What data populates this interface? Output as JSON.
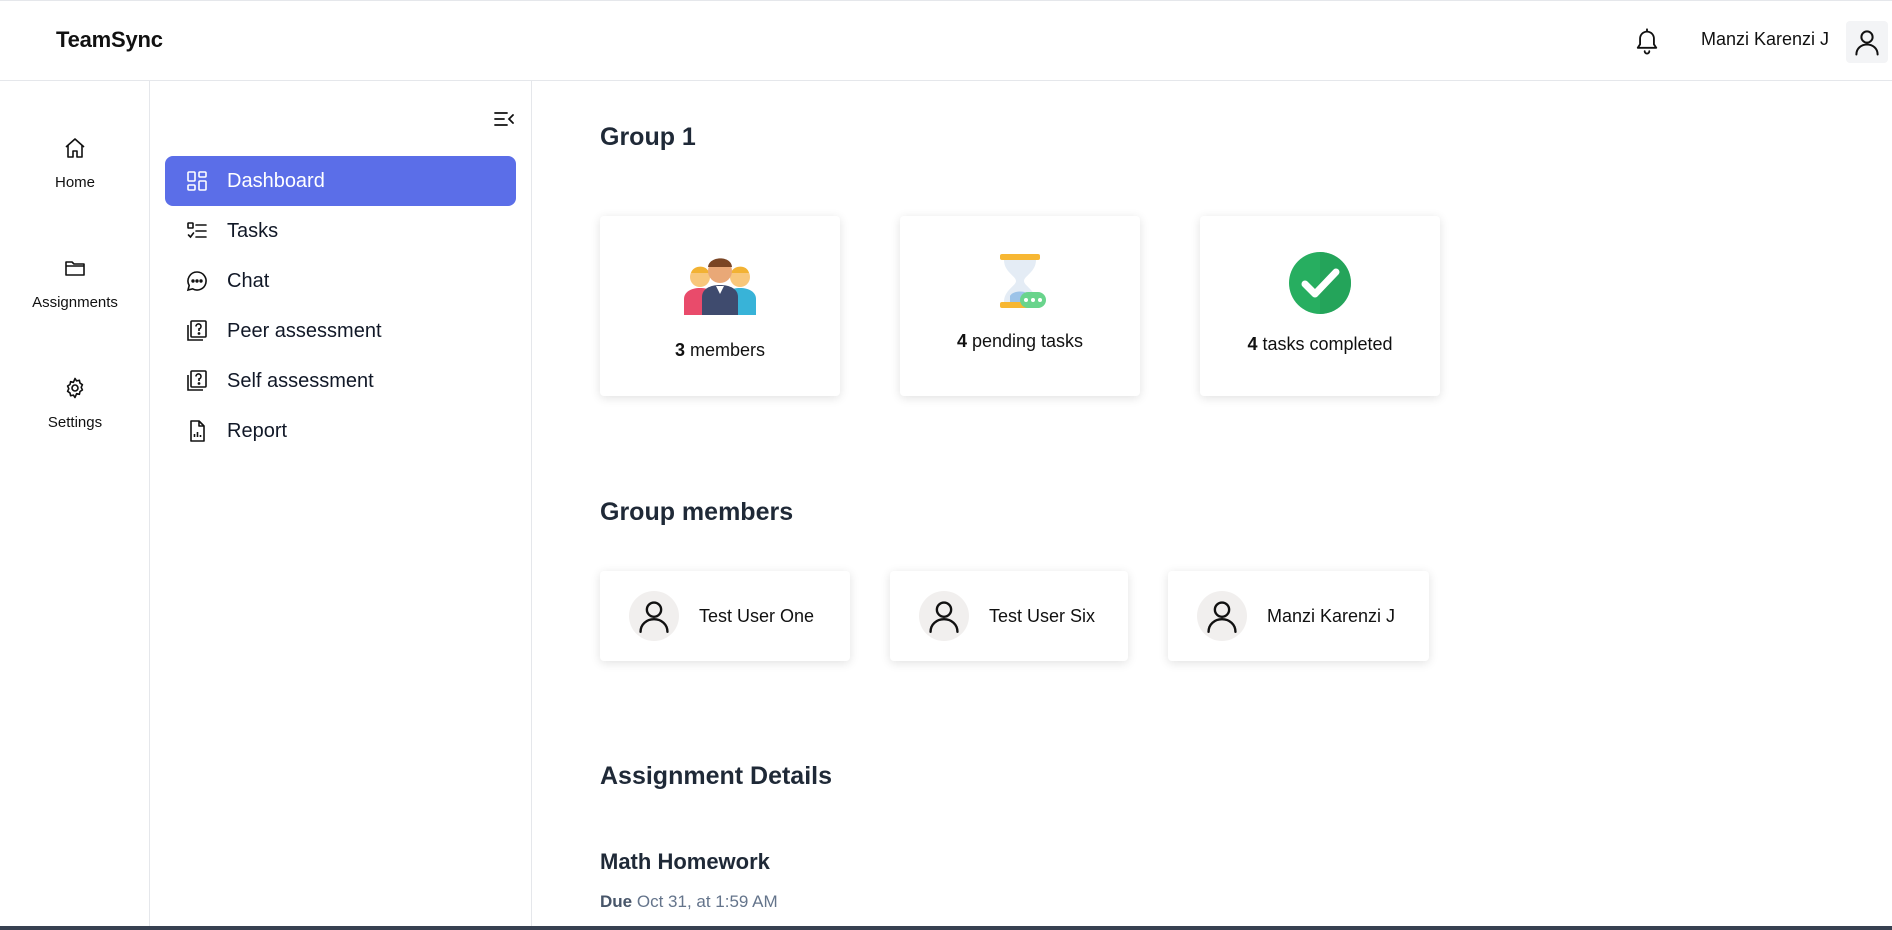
{
  "header": {
    "brand": "TeamSync",
    "user_name": "Manzi Karenzi J"
  },
  "rail": {
    "items": [
      {
        "label": "Home",
        "icon": "home-icon"
      },
      {
        "label": "Assignments",
        "icon": "folder-icon"
      },
      {
        "label": "Settings",
        "icon": "gear-icon"
      }
    ]
  },
  "sidenav": {
    "items": [
      {
        "label": "Dashboard",
        "icon": "dashboard-icon",
        "active": true
      },
      {
        "label": "Tasks",
        "icon": "tasks-icon"
      },
      {
        "label": "Chat",
        "icon": "chat-icon"
      },
      {
        "label": "Peer assessment",
        "icon": "peer-assessment-icon"
      },
      {
        "label": "Self assessment",
        "icon": "self-assessment-icon"
      },
      {
        "label": "Report",
        "icon": "report-icon"
      }
    ],
    "active_color": "#5b6ee8"
  },
  "main": {
    "group_title": "Group 1",
    "stats": [
      {
        "count": "3",
        "text": "members",
        "icon": "team-illustration"
      },
      {
        "count": "4",
        "text": "pending tasks",
        "icon": "hourglass-illustration"
      },
      {
        "count": "4",
        "text": "tasks completed",
        "icon": "check-circle-illustration"
      }
    ],
    "members_title": "Group members",
    "members": [
      {
        "name": "Test User One"
      },
      {
        "name": "Test User Six"
      },
      {
        "name": "Manzi Karenzi J"
      }
    ],
    "assignment_title": "Assignment Details",
    "assignment": {
      "name": "Math Homework",
      "due_label": "Due",
      "due_value": "Oct 31, at 1:59 AM"
    }
  }
}
